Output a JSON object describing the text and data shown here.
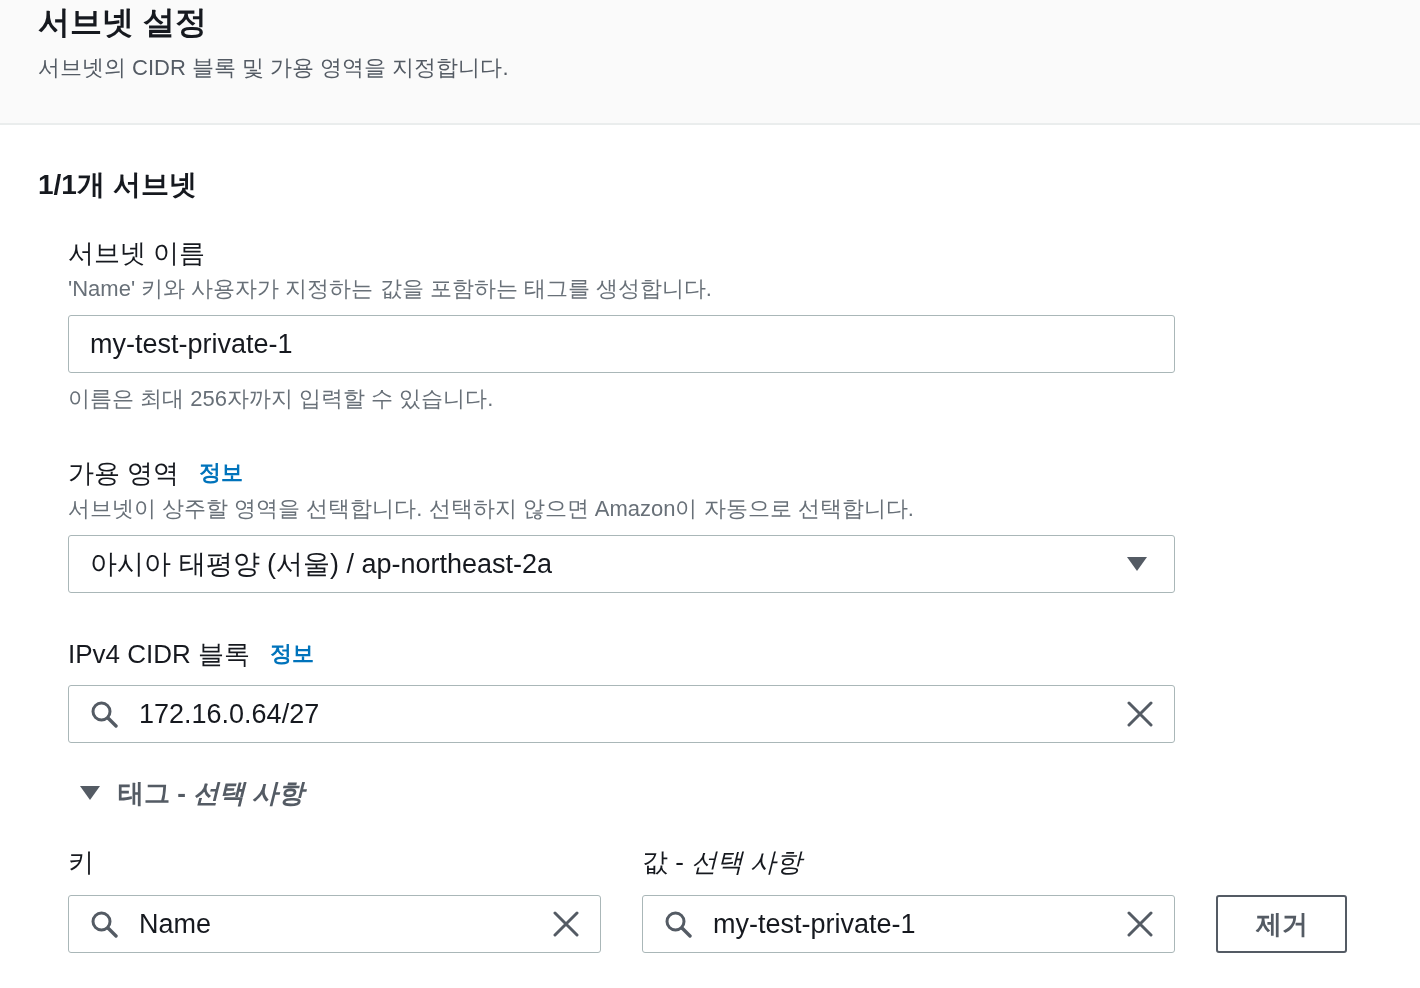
{
  "header": {
    "title": "서브넷 설정",
    "description": "서브넷의 CIDR 블록 및 가용 영역을 지정합니다."
  },
  "section": {
    "heading": "1/1개 서브넷",
    "fields": [
      {
        "kind": "text",
        "label": "서브넷 이름",
        "description": "'Name' 키와 사용자가 지정하는 값을 포함하는 태그를 생성합니다.",
        "value": "my-test-private-1",
        "hint": "이름은 최대 256자까지 입력할 수 있습니다."
      },
      {
        "kind": "select",
        "label": "가용 영역",
        "info_link": "정보",
        "description": "서브넷이 상주할 영역을 선택합니다. 선택하지 않으면 Amazon이 자동으로 선택합니다.",
        "value": "아시아 태평양 (서울) / ap-northeast-2a"
      },
      {
        "kind": "search",
        "label": "IPv4 CIDR 블록",
        "info_link": "정보",
        "value": "172.16.0.64/27"
      }
    ],
    "tags": {
      "title": "태그 - *선택 사항*",
      "expanded": true,
      "key_label": "키",
      "value_label": "값 - *선택 사항*",
      "rows": [
        {
          "key": "Name",
          "value": "my-test-private-1",
          "remove_button": "제거"
        }
      ]
    }
  }
}
